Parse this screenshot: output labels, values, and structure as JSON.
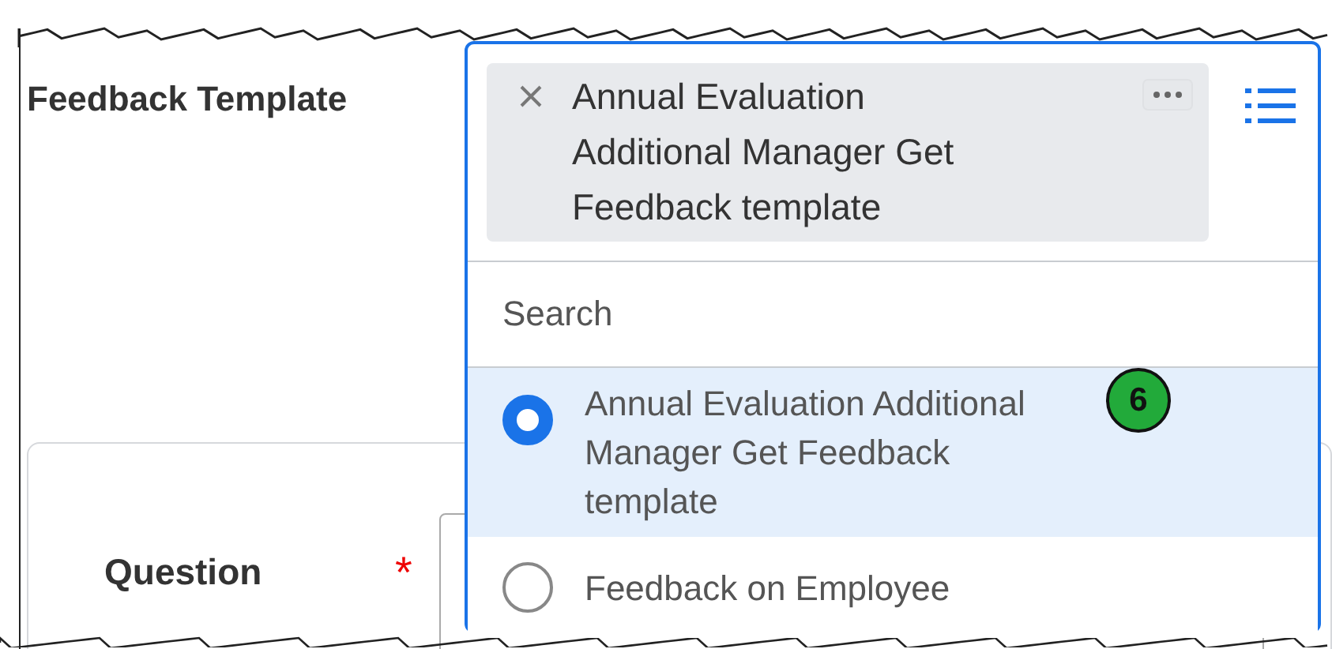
{
  "field": {
    "label": "Feedback Template",
    "selected_chip": "Annual Evaluation Additional Manager Get Feedback template",
    "search": {
      "placeholder": "Search"
    },
    "options": [
      {
        "label": "Annual Evaluation Additional Manager Get Feedback template",
        "selected": true
      },
      {
        "label": "Feedback on Employee",
        "selected": false
      }
    ]
  },
  "callout": "6",
  "question": {
    "label": "Question",
    "required": true,
    "required_mark": "*"
  }
}
